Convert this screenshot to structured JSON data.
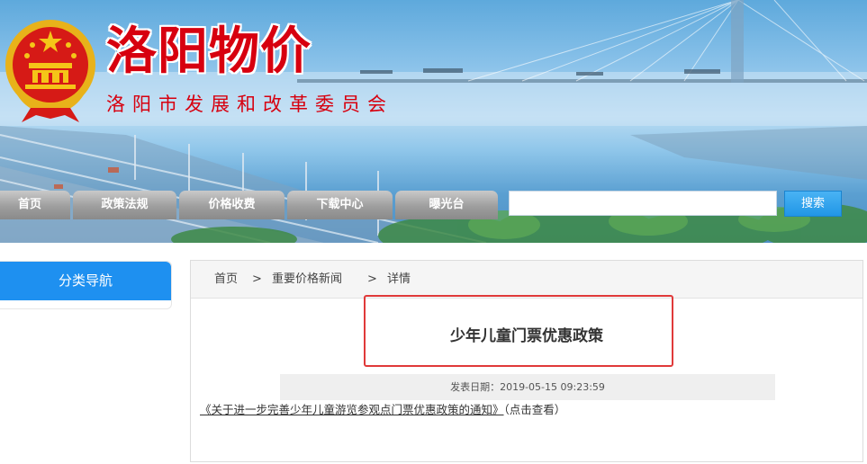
{
  "header": {
    "site_title": "洛阳物价",
    "site_subtitle": "洛阳市发展和改革委员会"
  },
  "nav": {
    "items": [
      "首页",
      "政策法规",
      "价格收费",
      "下载中心",
      "曝光台"
    ]
  },
  "search": {
    "value": "",
    "placeholder": "",
    "button_label": "搜索"
  },
  "sidebar": {
    "title": "分类导航"
  },
  "breadcrumb": {
    "items": [
      "首页",
      "重要价格新闻",
      "详情"
    ],
    "separator": ">"
  },
  "article": {
    "title": "少年儿童门票优惠政策",
    "meta": "发表日期：2019-05-15 09:23:59",
    "link_text": "《关于进一步完善少年儿童游览参观点门票优惠政策的通知》",
    "link_suffix": "（点击查看）"
  },
  "colors": {
    "title_red": "#d7000f",
    "sidebar_blue": "#1e90f0",
    "search_blue": "#2196e6",
    "highlight_red": "#e03a3a"
  }
}
